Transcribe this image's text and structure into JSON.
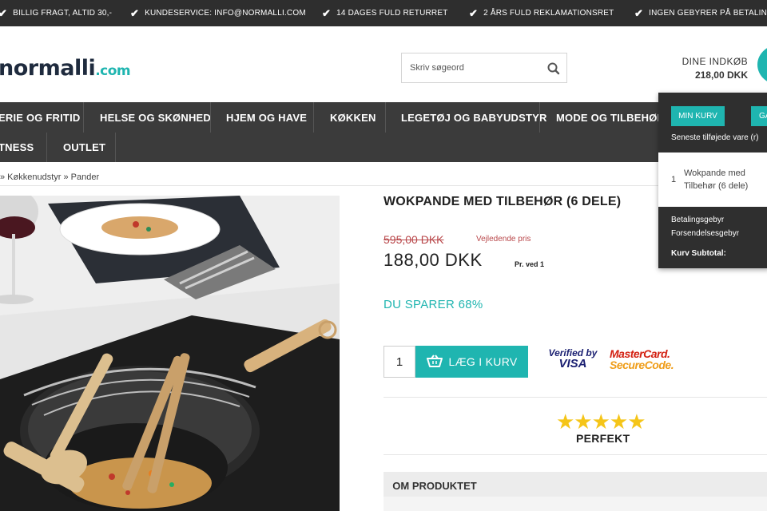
{
  "colors": {
    "accent": "#1fb5b0",
    "nav_bg": "#3b3b3b",
    "topbar_bg": "#2e2e2e",
    "sale_red": "#b9484b",
    "star": "#f5c518"
  },
  "topbar": {
    "perks": [
      "BILLIG FRAGT, ALTID 30,-",
      "KUNDESERVICE: INFO@NORMALLI.COM",
      "14 DAGES FULD RETURRET",
      "2 ÅRS FULD REKLAMATIONSRET",
      "INGEN GEBYRER PÅ BETALINGSKO"
    ]
  },
  "header": {
    "logo_main": "normalli",
    "logo_tld": ".com",
    "search_placeholder": "Skriv søgeord",
    "cart_label": "DINE INDKØB",
    "cart_amount": "218,00 DKK"
  },
  "nav": {
    "row1": [
      "ERIE OG FRITID",
      "HELSE OG SKØNHED",
      "HJEM OG HAVE",
      "KØKKEN",
      "LEGETØJ OG BABYUDSTYR",
      "MODE OG TILBEHØR"
    ],
    "row2": [
      "TNESS",
      "OUTLET"
    ]
  },
  "breadcrumb": "» Køkkenudstyr » Pander",
  "product": {
    "title": "WOKPANDE MED TILBEHØR (6 DELE)",
    "old_price": "595,00 DKK",
    "rrp_label": "Vejledende pris",
    "price": "188,00 DKK",
    "unit": "Pr.  ved 1",
    "savings": "DU SPARER 68%",
    "quantity": "1",
    "add_to_cart": "LÆG I KURV",
    "visa_line1": "Verified by",
    "visa_line2": "VISA",
    "mc_line1": "MasterCard.",
    "mc_line2": "SecureCode.",
    "stars": "★★★★★",
    "rating_label": "PERFEKT",
    "tab_about": "OM PRODUKTET"
  },
  "minicart": {
    "btn_cart": "MIN KURV",
    "btn_checkout": "GA",
    "recent_label": "Seneste tilføjede vare (r)",
    "item_qty": "1",
    "item_name": "Wokpande med Tilbehør (6 dele)",
    "fee_payment": "Betalingsgebyr",
    "fee_shipping": "Forsendelsesgebyr",
    "subtotal_label": "Kurv Subtotal:"
  }
}
